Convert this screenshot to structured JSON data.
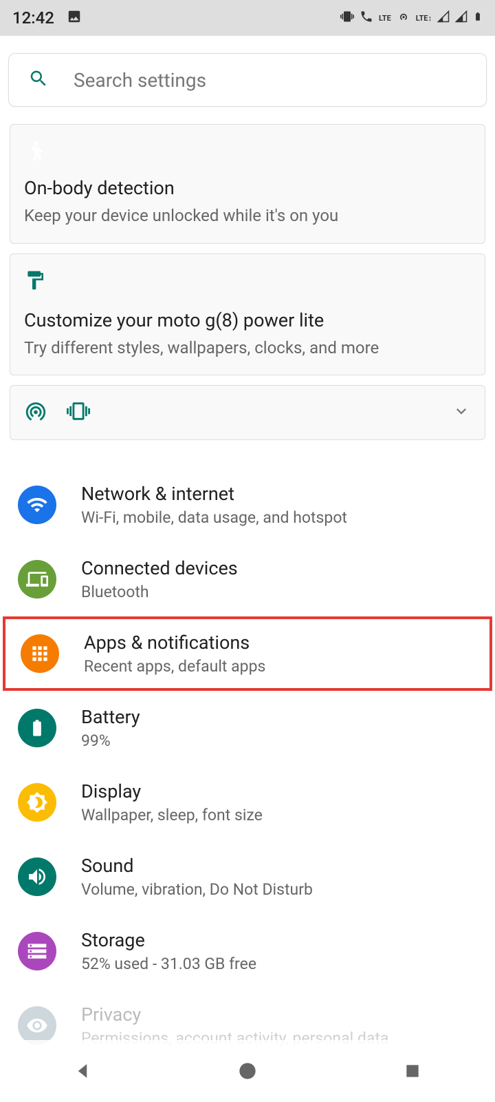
{
  "status": {
    "time": "12:42",
    "lte_label": "LTE",
    "lte2_label": "LTE↕"
  },
  "search": {
    "placeholder": "Search settings"
  },
  "cards": {
    "onbody": {
      "title": "On-body detection",
      "subtitle": "Keep your device unlocked while it's on you"
    },
    "customize": {
      "title": "Customize your moto g(8) power lite",
      "subtitle": "Try different styles, wallpapers, clocks, and more"
    }
  },
  "settings": [
    {
      "title": "Network & internet",
      "subtitle": "Wi-Fi, mobile, data usage, and hotspot"
    },
    {
      "title": "Connected devices",
      "subtitle": "Bluetooth"
    },
    {
      "title": "Apps & notifications",
      "subtitle": "Recent apps, default apps"
    },
    {
      "title": "Battery",
      "subtitle": "99%"
    },
    {
      "title": "Display",
      "subtitle": "Wallpaper, sleep, font size"
    },
    {
      "title": "Sound",
      "subtitle": "Volume, vibration, Do Not Disturb"
    },
    {
      "title": "Storage",
      "subtitle": "52% used - 31.03 GB free"
    },
    {
      "title": "Privacy",
      "subtitle": "Permissions, account activity, personal data"
    }
  ]
}
